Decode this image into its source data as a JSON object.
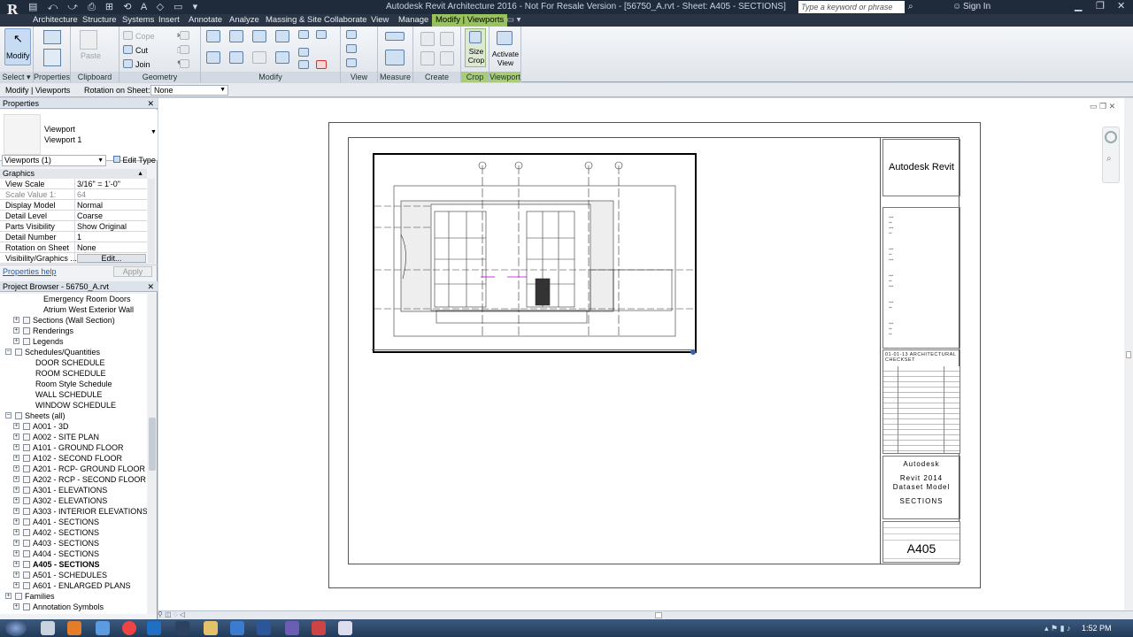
{
  "app": {
    "window_title": "Autodesk Revit Architecture 2016 - Not For Resale Version - [56750_A.rvt - Sheet: A405 - SECTIONS]",
    "search_placeholder": "Type a keyword or phrase",
    "sign_in": "Sign In",
    "app_button": "R"
  },
  "ribbon_tabs": [
    "Architecture",
    "Structure",
    "Systems",
    "Insert",
    "Annotate",
    "Analyze",
    "Massing & Site",
    "Collaborate",
    "View",
    "Manage",
    "Modify | Viewports"
  ],
  "active_tab": "Modify | Viewports",
  "ribbon": {
    "modify": "Modify",
    "select": "Select ▾",
    "properties": "Properties",
    "paste": "Paste",
    "clipboard": "Clipboard",
    "cope": "Cope",
    "cut": "Cut",
    "join": "Join",
    "geometry": "Geometry",
    "modify_panel": "Modify",
    "view_panel": "View",
    "measure_panel": "Measure",
    "create_panel": "Create",
    "size_crop": "Size Crop",
    "crop_panel": "Crop",
    "activate_view": "Activate View",
    "viewport_panel": "Viewport"
  },
  "options_bar": {
    "context": "Modify | Viewports",
    "rotation_label": "Rotation on Sheet:",
    "rotation_value": "None"
  },
  "properties": {
    "header": "Properties",
    "type_family": "Viewport",
    "type_name": "Viewport 1",
    "selector": "Viewports (1)",
    "edit_type": "Edit Type",
    "group": "Graphics",
    "rows": [
      {
        "k": "View Scale",
        "v": "3/16\" = 1'-0\""
      },
      {
        "k": "Scale Value    1:",
        "v": "64"
      },
      {
        "k": "Display Model",
        "v": "Normal"
      },
      {
        "k": "Detail Level",
        "v": "Coarse"
      },
      {
        "k": "Parts Visibility",
        "v": "Show Original"
      },
      {
        "k": "Detail Number",
        "v": "1"
      },
      {
        "k": "Rotation on Sheet",
        "v": "None"
      },
      {
        "k": "Visibility/Graphics ...",
        "v": "Edit..."
      }
    ],
    "help": "Properties help",
    "apply": "Apply"
  },
  "browser": {
    "header": "Project Browser - 56750_A.rvt",
    "items": [
      {
        "label": "Emergency Room Doors",
        "indent": 3,
        "exp": ""
      },
      {
        "label": "Atrium West Exterior Wall",
        "indent": 3,
        "exp": ""
      },
      {
        "label": "Sections (Wall Section)",
        "indent": 1,
        "exp": "+"
      },
      {
        "label": "Renderings",
        "indent": 1,
        "exp": "+"
      },
      {
        "label": "Legends",
        "indent": 1,
        "exp": "+"
      },
      {
        "label": "Schedules/Quantities",
        "indent": 0,
        "exp": "−"
      },
      {
        "label": "DOOR SCHEDULE",
        "indent": 2,
        "exp": ""
      },
      {
        "label": "ROOM SCHEDULE",
        "indent": 2,
        "exp": ""
      },
      {
        "label": "Room Style Schedule",
        "indent": 2,
        "exp": ""
      },
      {
        "label": "WALL SCHEDULE",
        "indent": 2,
        "exp": ""
      },
      {
        "label": "WINDOW SCHEDULE",
        "indent": 2,
        "exp": ""
      },
      {
        "label": "Sheets (all)",
        "indent": 0,
        "exp": "−"
      },
      {
        "label": "A001 - 3D",
        "indent": 1,
        "exp": "+"
      },
      {
        "label": "A002 - SITE PLAN",
        "indent": 1,
        "exp": "+"
      },
      {
        "label": "A101 - GROUND FLOOR",
        "indent": 1,
        "exp": "+"
      },
      {
        "label": "A102 - SECOND FLOOR",
        "indent": 1,
        "exp": "+"
      },
      {
        "label": "A201 - RCP- GROUND FLOOR",
        "indent": 1,
        "exp": "+"
      },
      {
        "label": "A202 - RCP - SECOND FLOOR",
        "indent": 1,
        "exp": "+"
      },
      {
        "label": "A301 - ELEVATIONS",
        "indent": 1,
        "exp": "+"
      },
      {
        "label": "A302 - ELEVATIONS",
        "indent": 1,
        "exp": "+"
      },
      {
        "label": "A303 - INTERIOR ELEVATIONS",
        "indent": 1,
        "exp": "+"
      },
      {
        "label": "A401 - SECTIONS",
        "indent": 1,
        "exp": "+"
      },
      {
        "label": "A402 - SECTIONS",
        "indent": 1,
        "exp": "+"
      },
      {
        "label": "A403 - SECTIONS",
        "indent": 1,
        "exp": "+"
      },
      {
        "label": "A404 - SECTIONS",
        "indent": 1,
        "exp": "+"
      },
      {
        "label": "A405 - SECTIONS",
        "indent": 1,
        "exp": "+",
        "bold": true
      },
      {
        "label": "A501 - SCHEDULES",
        "indent": 1,
        "exp": "+"
      },
      {
        "label": "A601 - ENLARGED PLANS",
        "indent": 1,
        "exp": "+"
      },
      {
        "label": "Families",
        "indent": 0,
        "exp": "+"
      },
      {
        "label": "Annotation Symbols",
        "indent": 1,
        "exp": "+"
      }
    ]
  },
  "titleblock": {
    "brand": "Autodesk Revit",
    "checklist": "01-01-13 ARCHITECTURAL CHECKSET",
    "company": "Autodesk",
    "project_line1": "Revit 2014",
    "project_line2": "Dataset Model",
    "sheet_title": "SECTIONS",
    "sheet_number": "A405"
  },
  "clock": "1:52 PM"
}
